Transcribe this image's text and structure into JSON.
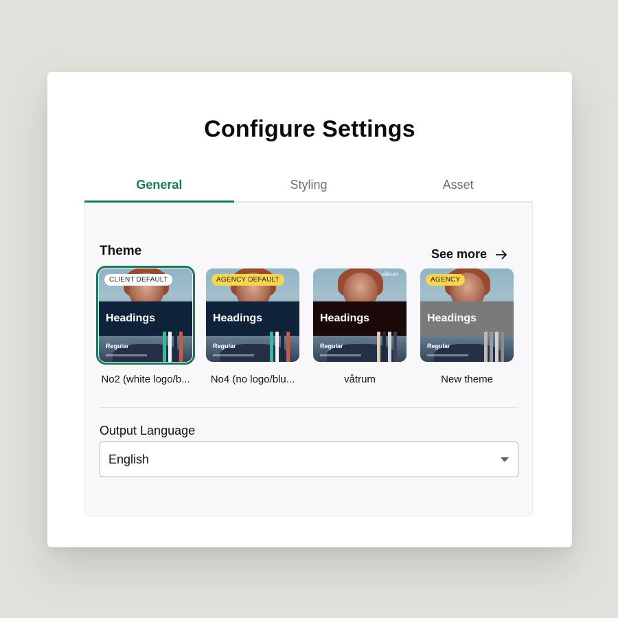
{
  "dialog": {
    "title": "Configure Settings"
  },
  "tabs": [
    {
      "label": "General",
      "active": true
    },
    {
      "label": "Styling",
      "active": false
    },
    {
      "label": "Asset",
      "active": false
    }
  ],
  "theme": {
    "section_label": "Theme",
    "see_more_label": "See more",
    "cards": [
      {
        "name": "No2 (white logo/b...",
        "badge": "CLIENT DEFAULT",
        "badge_color": "#ffffff",
        "heading": "Headings",
        "body": "Regular",
        "band_color": "#0e2339",
        "stripes": [
          "#1fc59a",
          "#f4f1ea",
          "#1b2a3c",
          "#e1512f"
        ],
        "selected": true,
        "logo": ""
      },
      {
        "name": "No4 (no logo/blu...",
        "badge": "AGENCY DEFAULT",
        "badge_color": "#f6d64a",
        "heading": "Headings",
        "body": "Regular",
        "band_color": "#0e2339",
        "stripes": [
          "#1fc59a",
          "#f4f1ea",
          "#1b2a3c",
          "#e1512f"
        ],
        "selected": false,
        "logo": ""
      },
      {
        "name": "våtrum",
        "badge": "",
        "badge_color": "",
        "heading": "Headings",
        "body": "Regular",
        "band_color": "#1a0908",
        "stripes": [
          "#e9c8a6",
          "#1b2a3c",
          "#d9d5cf",
          "#3a4456"
        ],
        "selected": false,
        "logo": "våtrum"
      },
      {
        "name": "New theme",
        "badge": "AGENCY",
        "badge_color": "#f6d64a",
        "heading": "Headings",
        "body": "Regular",
        "band_color": "#7a7a7a",
        "stripes": [
          "#c9b7a3",
          "#9a9a9a",
          "#d8cfc2",
          "#8a8a8a"
        ],
        "selected": false,
        "logo": ""
      }
    ]
  },
  "output_language": {
    "label": "Output Language",
    "value": "English"
  },
  "colors": {
    "accent": "#177a5a",
    "background": "#dfe1db"
  }
}
